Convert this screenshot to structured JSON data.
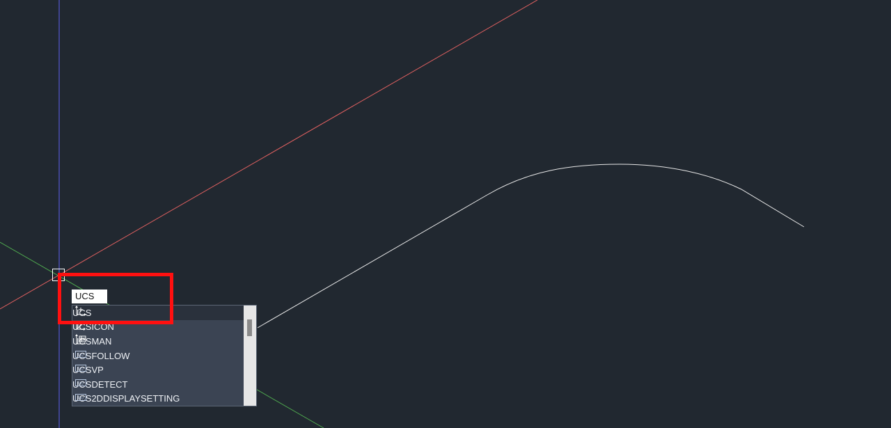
{
  "command_line": {
    "input_value": "UCS"
  },
  "autocomplete": {
    "items": [
      {
        "label": "UCS",
        "icon": "ucs-axes-icon",
        "selected": true
      },
      {
        "label": "UCSICON",
        "icon": "ucs-icon-settings-icon",
        "selected": false
      },
      {
        "label": "UCSMAN",
        "icon": "ucs-manager-icon",
        "selected": false
      },
      {
        "label": "UCSFOLLOW",
        "icon": "system-variable-icon",
        "selected": false
      },
      {
        "label": "UCSVP",
        "icon": "system-variable-icon",
        "selected": false
      },
      {
        "label": "UCSDETECT",
        "icon": "system-variable-icon",
        "selected": false
      },
      {
        "label": "UCS2DDISPLAYSETTING",
        "icon": "system-variable-icon",
        "selected": false
      }
    ]
  },
  "colors": {
    "canvas_background": "#212830",
    "x_axis": "#e06060",
    "y_axis": "#6060ee",
    "z_axis": "#4fa84f",
    "polyline": "#e8e8e8",
    "highlight": "#ff1010"
  }
}
